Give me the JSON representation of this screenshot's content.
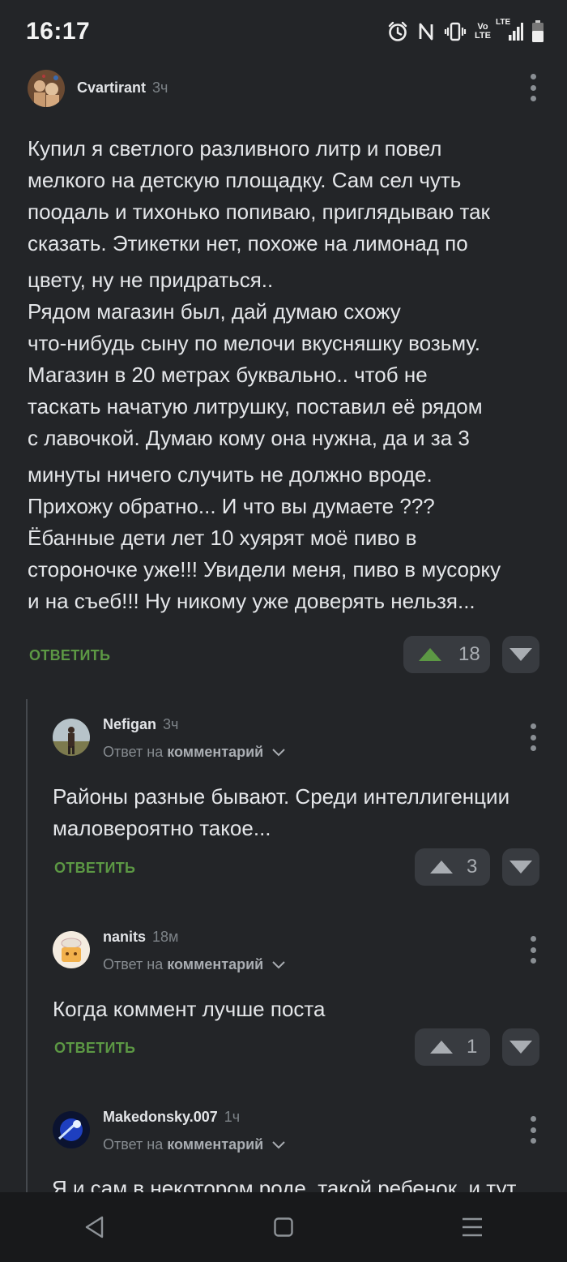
{
  "status_bar": {
    "time": "16:17",
    "icons": [
      "alarm-icon",
      "nfc-icon",
      "vibrate-icon",
      "volte-icon",
      "lte-signal-icon",
      "battery-icon"
    ],
    "volte_label": "Vo LTE",
    "lte_label": "LTE"
  },
  "colors": {
    "background": "#232528",
    "accent_green": "#5c9844",
    "vote_box": "#383b40",
    "nav_bar": "#18191b"
  },
  "comments": [
    {
      "author": "Cvartirant",
      "age": "3ч",
      "text_lines": [
        "Купил я светлого разливного литр и повел",
        "мелкого на детскую площадку. Сам сел чуть",
        "поодаль и тихонько попиваю, приглядываю так",
        "сказать. Этикетки нет, похоже на лимонад по",
        "цвету, ну не придраться..",
        "Рядом магазин был, дай думаю схожу",
        "что-нибудь сыну по мелочи вкусняшку возьму.",
        "Магазин в 20 метрах буквально.. чтоб не",
        "таскать начатую литрушку, поставил её рядом",
        "с лавочкой. Думаю кому она нужна, да и за 3",
        "минуты ничего случить не должно вроде.",
        "Прихожу обратно... И что вы думаете ???",
        "Ёбанные дети лет 10 хуярят моё пиво в",
        "стороночке уже!!! Увидели меня, пиво в мусорку",
        "и на съеб!!! Ну никому уже доверять нельзя..."
      ],
      "reply_label": "ОТВЕТИТЬ",
      "votes": "18",
      "upvoted": true
    },
    {
      "author": "Nefigan",
      "age": "3ч",
      "reply_prefix": "Ответ на",
      "reply_target": "комментарий",
      "text_lines": [
        "Районы разные бывают. Среди интеллигенции",
        "маловероятно такое..."
      ],
      "reply_label": "ОТВЕТИТЬ",
      "votes": "3"
    },
    {
      "author": "nanits",
      "age": "18м",
      "reply_prefix": "Ответ на",
      "reply_target": "комментарий",
      "text_lines": [
        "Когда коммент лучше поста"
      ],
      "reply_label": "ОТВЕТИТЬ",
      "votes": "1"
    },
    {
      "author": "Makedonsky.007",
      "age": "1ч",
      "reply_prefix": "Ответ на",
      "reply_target": "комментарий",
      "text_lines": [
        "Я и сам в некотором роде, такой ребенок, и тут"
      ]
    }
  ],
  "nav_bar": {
    "icons": [
      "back-icon",
      "home-icon",
      "recents-icon"
    ]
  }
}
